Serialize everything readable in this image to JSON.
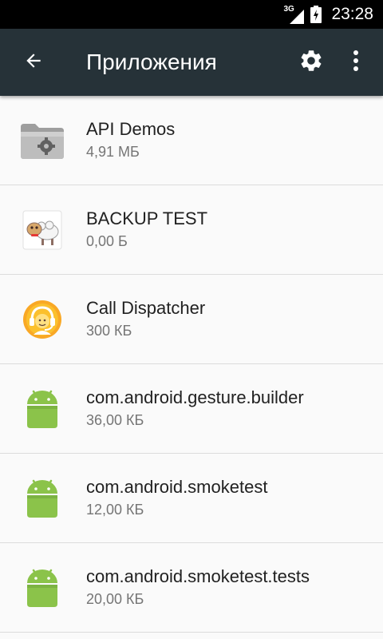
{
  "status_bar": {
    "network_type": "3G",
    "time": "23:28"
  },
  "toolbar": {
    "title": "Приложения",
    "back_icon": "arrow-back-icon",
    "settings_icon": "gear-icon",
    "more_icon": "more-vert-icon",
    "background": "#263238"
  },
  "apps": [
    {
      "name": "API Demos",
      "size": "4,91 МБ",
      "icon": "folder-gear-icon"
    },
    {
      "name": "BACKUP TEST",
      "size": "0,00 Б",
      "icon": "sheep-icon"
    },
    {
      "name": "Call Dispatcher",
      "size": "300 КБ",
      "icon": "headset-operator-icon"
    },
    {
      "name": "com.android.gesture.builder",
      "size": "36,00 КБ",
      "icon": "android-icon"
    },
    {
      "name": "com.android.smoketest",
      "size": "12,00 КБ",
      "icon": "android-icon"
    },
    {
      "name": "com.android.smoketest.tests",
      "size": "20,00 КБ",
      "icon": "android-icon"
    }
  ],
  "colors": {
    "android_green": "#8bc34a",
    "divider": "#dcdcdc",
    "list_background": "#fafafa"
  }
}
